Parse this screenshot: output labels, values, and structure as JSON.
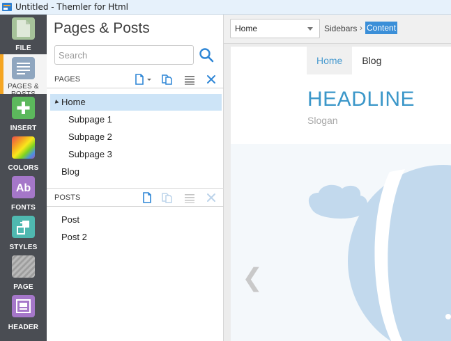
{
  "window": {
    "title": "Untitled - Themler for Html"
  },
  "nav": {
    "items": [
      {
        "label": "FILE",
        "icon": "file-icon",
        "color": "#a6c29a"
      },
      {
        "label": "PAGES & POSTS",
        "icon": "pages-icon",
        "color": "#e8eef4"
      },
      {
        "label": "INSERT",
        "icon": "plus-icon",
        "color": "#5cb85c"
      },
      {
        "label": "COLORS",
        "icon": "palette-icon",
        "color": "#f0a43a"
      },
      {
        "label": "FONTS",
        "icon": "fonts-icon",
        "color": "#a577c9"
      },
      {
        "label": "STYLES",
        "icon": "styles-icon",
        "color": "#4fb8b0"
      },
      {
        "label": "PAGE",
        "icon": "page-icon",
        "color": "#a8a8a8"
      },
      {
        "label": "HEADER",
        "icon": "header-icon",
        "color": "#a577c9"
      }
    ]
  },
  "panel": {
    "title": "Pages & Posts",
    "search": {
      "placeholder": "Search",
      "value": ""
    },
    "pages_section": {
      "label": "PAGES"
    },
    "pages": [
      {
        "label": "Home",
        "selected": true,
        "expanded": true
      },
      {
        "label": "Subpage 1"
      },
      {
        "label": "Subpage 2"
      },
      {
        "label": "Subpage 3"
      },
      {
        "label": "Blog"
      }
    ],
    "posts_section": {
      "label": "POSTS"
    },
    "posts": [
      {
        "label": "Post"
      },
      {
        "label": "Post 2"
      }
    ]
  },
  "canvas": {
    "select": {
      "value": "Home"
    },
    "breadcrumb": {
      "first": "Sidebars",
      "separator": "›",
      "active": "Content"
    },
    "preview": {
      "menu": [
        "Home",
        "Blog"
      ],
      "headline": "HEADLINE",
      "slogan": "Slogan",
      "prev_arrow": "❮"
    }
  },
  "colors": {
    "accent": "#3b8fd8",
    "sidebar_bg": "#4a4d53",
    "active_marker": "#f5a623",
    "headline": "#3b97c9"
  }
}
